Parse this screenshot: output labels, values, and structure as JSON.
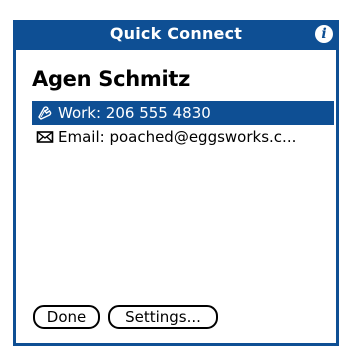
{
  "dialog": {
    "title": "Quick Connect",
    "info_icon": "i"
  },
  "contact": {
    "name": "Agen Schmitz",
    "methods": [
      {
        "icon": "phone-icon",
        "label": "Work: 206 555 4830",
        "selected": true
      },
      {
        "icon": "mail-icon",
        "label": "Email: poached@eggsworks.c...",
        "selected": false
      }
    ]
  },
  "buttons": {
    "done": "Done",
    "settings": "Settings..."
  },
  "colors": {
    "accent": "#0e4f94",
    "background": "#ffffff"
  }
}
